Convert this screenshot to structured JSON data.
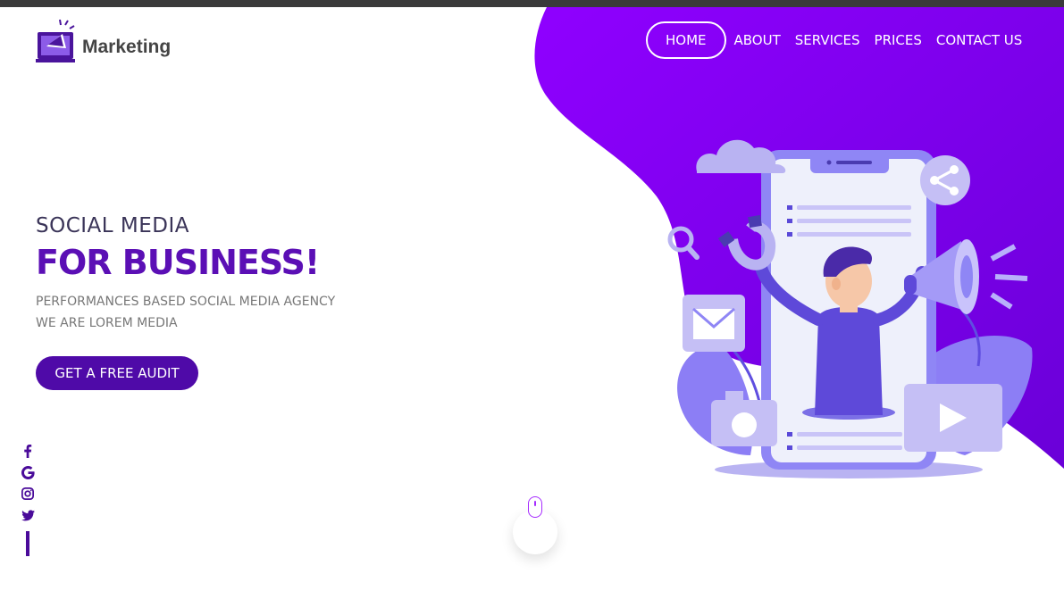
{
  "brand": {
    "name": "Marketing"
  },
  "nav": {
    "items": [
      {
        "label": "HOME",
        "active": true
      },
      {
        "label": "ABOUT",
        "active": false
      },
      {
        "label": "SERVICES",
        "active": false
      },
      {
        "label": "PRICES",
        "active": false
      },
      {
        "label": "CONTACT US",
        "active": false
      }
    ]
  },
  "hero": {
    "subtitle": "SOCIAL MEDIA",
    "title": "FOR BUSINESS!",
    "desc_line1": "PERFORMANCES BASED SOCIAL MEDIA AGENCY",
    "desc_line2": "WE ARE LOREM MEDIA",
    "cta_label": "GET A FREE AUDIT"
  },
  "social": [
    {
      "icon": "facebook-icon"
    },
    {
      "icon": "google-icon"
    },
    {
      "icon": "instagram-icon"
    },
    {
      "icon": "twitter-icon"
    }
  ],
  "colors": {
    "primary": "#5b0fb5",
    "accent": "#8a00ff",
    "button": "#4f0aa8",
    "illustration_light": "#c5bff5"
  }
}
